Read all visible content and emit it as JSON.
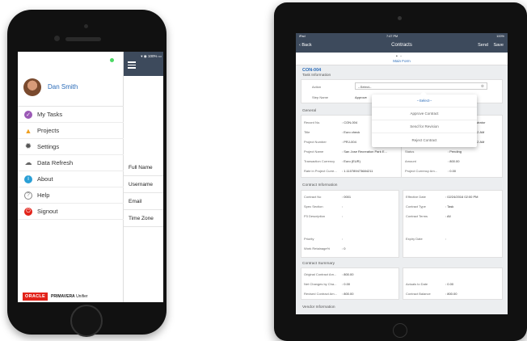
{
  "phone": {
    "user_name": "Dan Smith",
    "menu": [
      {
        "label": "My Tasks",
        "icon": "check-circle-icon",
        "color": "#9b59b6"
      },
      {
        "label": "Projects",
        "icon": "projects-icon",
        "color": "#f0a020"
      },
      {
        "label": "Settings",
        "icon": "gear-icon",
        "color": "#555555"
      },
      {
        "label": "Data Refresh",
        "icon": "cloud-icon",
        "color": "#666666"
      },
      {
        "label": "About",
        "icon": "info-icon",
        "color": "#2a9fd6"
      },
      {
        "label": "Help",
        "icon": "help-icon",
        "color": "#888888"
      },
      {
        "label": "Signout",
        "icon": "power-icon",
        "color": "#e2231a"
      }
    ],
    "footer": {
      "oracle": "ORACLE",
      "primavera": "PRIMAVERA",
      "unifier": "Unifier"
    },
    "right_fields": [
      "Full Name",
      "Username",
      "Email",
      "Time Zone"
    ]
  },
  "tablet": {
    "status_left": "iPad",
    "status_time": "7:47 PM",
    "status_right": "100%",
    "back_label": "Back",
    "title": "Contracts",
    "send_label": "Send",
    "save_label": "Save",
    "form_link": "Main Form",
    "record_id": "CON-004",
    "task_section": "Task Information",
    "action_label": "Action",
    "action_value": "--Select--",
    "step_label": "Step Name",
    "step_value": "Approve",
    "dropdown": [
      "--Select--",
      "Approve Contract",
      "Send for Revision",
      "Reject Contract"
    ],
    "general_section": "General",
    "general_left": [
      {
        "label": "Record No.",
        "value": "CON-004"
      },
      {
        "label": "Title",
        "value": "Euro check"
      },
      {
        "label": "Project Number",
        "value": "PRJ-004"
      },
      {
        "label": "Project Name",
        "value": "San Jose Recreation Park E..."
      },
      {
        "label": "Transaction Currency",
        "value": "Euro (EUR)"
      },
      {
        "label": "Rate in Project Curre...",
        "value": "1.110789473684211"
      }
    ],
    "general_right": [
      {
        "label": "",
        "value": "nistrator"
      },
      {
        "label": "",
        "value": "52 AM"
      },
      {
        "label": "",
        "value": "52 AM"
      },
      {
        "label": "Status",
        "value": "Pending"
      },
      {
        "label": "Amount",
        "value": "800.00"
      },
      {
        "label": "Project Currency Am...",
        "value": "0.00"
      }
    ],
    "contract_section": "Contract Information",
    "contract_left": [
      {
        "label": "Contract No",
        "value": "0001"
      },
      {
        "label": "Spec Section",
        "value": ""
      },
      {
        "label": "P3 Description",
        "value": ""
      },
      {
        "label": "Priority",
        "value": ""
      },
      {
        "label": "Work Retainage%",
        "value": "0"
      }
    ],
    "contract_right": [
      {
        "label": "Effective Date",
        "value": "02/24/2016 02:00 PM"
      },
      {
        "label": "Contract Type",
        "value": "Task"
      },
      {
        "label": "Contract Terms",
        "value": "All"
      },
      {
        "label": "Expiry Date",
        "value": ""
      }
    ],
    "summary_section": "Contract Summary",
    "summary_left": [
      {
        "label": "Original Contract Am...",
        "value": "800.00"
      },
      {
        "label": "Net Changes by Cha...",
        "value": "0.00"
      },
      {
        "label": "Revised Contract Am...",
        "value": "800.00"
      }
    ],
    "summary_right": [
      {
        "label": "Actuals to Date",
        "value": "0.00"
      },
      {
        "label": "Contract Balance",
        "value": "800.00"
      }
    ],
    "vendor_section": "Vendor Information"
  }
}
